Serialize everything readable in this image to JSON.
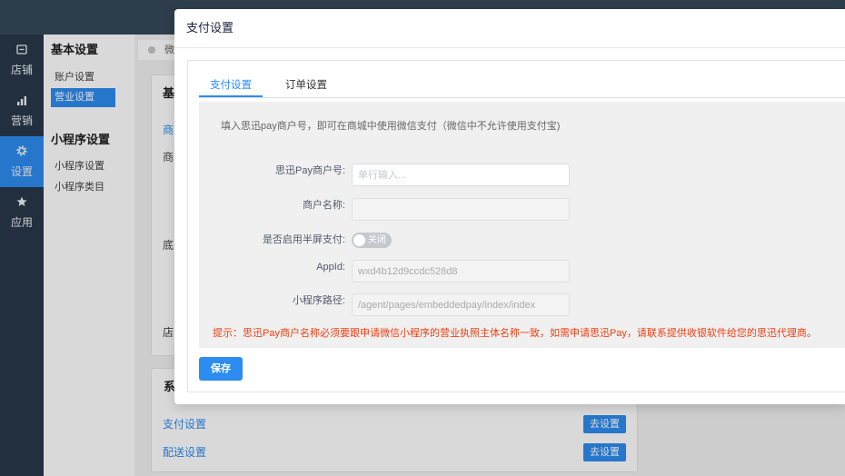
{
  "colors": {
    "accent": "#2d8cf0",
    "tip": "#ed4014",
    "topbar": "#364859",
    "nav": "#29384a"
  },
  "nav": {
    "items": [
      {
        "label": "店铺",
        "icon": "store-icon",
        "active": false
      },
      {
        "label": "营销",
        "icon": "bar-chart-icon",
        "active": false
      },
      {
        "label": "设置",
        "icon": "gear-icon",
        "active": true
      },
      {
        "label": "应用",
        "icon": "star-icon",
        "active": false
      }
    ]
  },
  "subnav": {
    "groups": [
      {
        "title": "基本设置",
        "items": [
          {
            "label": "账户设置",
            "active": false
          },
          {
            "label": "营业设置",
            "active": true
          }
        ]
      },
      {
        "title": "小程序设置",
        "items": [
          {
            "label": "小程序设置",
            "active": false
          },
          {
            "label": "小程序类目",
            "active": false
          }
        ]
      }
    ]
  },
  "page_tab": {
    "label": "微"
  },
  "background": {
    "card1": {
      "title": "基",
      "lines": [
        "商",
        "商",
        "底",
        "店"
      ]
    },
    "card2": {
      "title": "系",
      "rows": [
        {
          "label": "支付设置",
          "button": "去设置"
        },
        {
          "label": "配送设置",
          "button": "去设置"
        }
      ]
    }
  },
  "modal": {
    "title": "支付设置",
    "tabs": [
      {
        "label": "支付设置",
        "active": true
      },
      {
        "label": "订单设置",
        "active": false
      }
    ],
    "description": "填入思迅pay商户号，即可在商城中使用微信支付（微信中不允许使用支付宝)",
    "fields": {
      "merchant_no": {
        "label": "思迅Pay商户号:",
        "value": "",
        "placeholder": "单行输入..."
      },
      "merchant_name": {
        "label": "商户名称:",
        "value": ""
      },
      "half_screen": {
        "label": "是否启用半屏支付:",
        "toggle_text": "关闭",
        "enabled": false
      },
      "app_id": {
        "label": "AppId:",
        "value": "wxd4b12d9ccdc528d8"
      },
      "mini_path": {
        "label": "小程序路径:",
        "value": "/agent/pages/embeddedpay/index/index"
      }
    },
    "tip": "提示：思迅Pay商户名称必须要跟申请微信小程序的营业执照主体名称一致，如需申请思迅Pay，请联系提供收银软件给您的思迅代理商。",
    "save_label": "保存"
  }
}
